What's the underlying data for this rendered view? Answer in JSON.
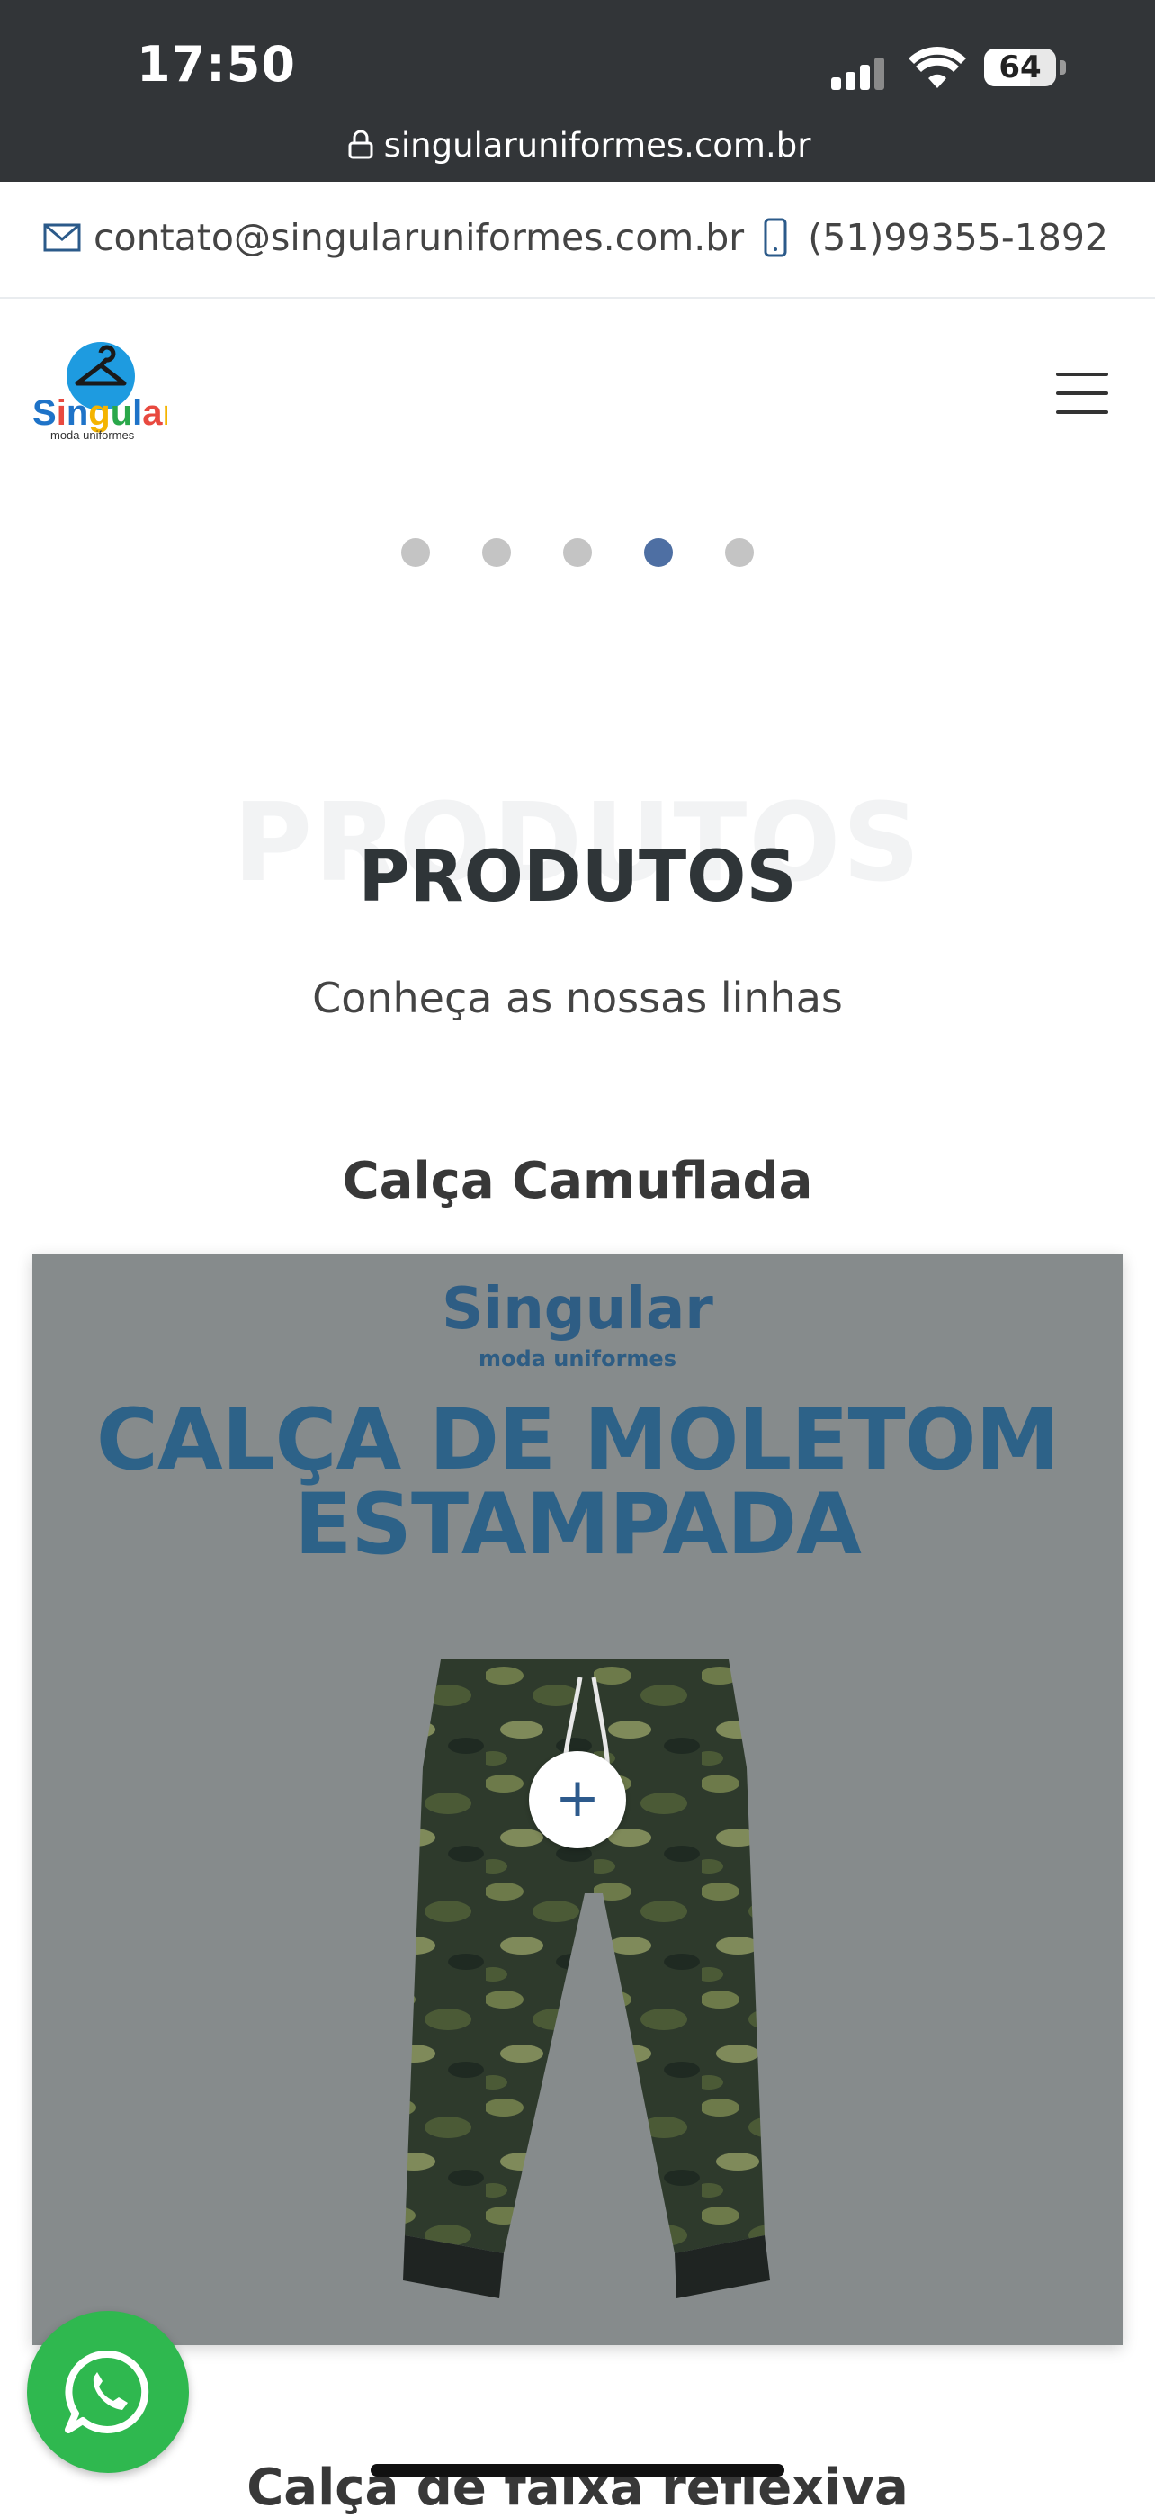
{
  "status_bar": {
    "time": "17:50",
    "battery": "64"
  },
  "browser": {
    "url": "singularuniformes.com.br"
  },
  "contact": {
    "email": "contato@singularuniformes.com.br",
    "phone": "(51)99355-1892"
  },
  "carousel": {
    "slide_count": 5,
    "active_index": 3
  },
  "section": {
    "background_title": "PRODUTOS",
    "title": "PRODUTOS",
    "subtitle": "Conheça as nossas linhas"
  },
  "products": [
    {
      "title": "Calça Camuflada",
      "image_brand": "Singular",
      "image_brand_sub": "moda uniformes",
      "image_headline_line1": "CALÇA DE MOLETOM",
      "image_headline_line2": "ESTAMPADA",
      "more_label": "+"
    },
    {
      "title": "Calça de faixa reflexiva"
    }
  ],
  "colors": {
    "accent": "#4e6fa3",
    "whatsapp": "#2fb84f",
    "headline": "#2d6288",
    "card_bg": "#868b8c"
  },
  "icons": {
    "menu": "hamburger-icon",
    "whatsapp": "whatsapp-icon",
    "email": "mail-icon",
    "phone": "phone-icon"
  }
}
